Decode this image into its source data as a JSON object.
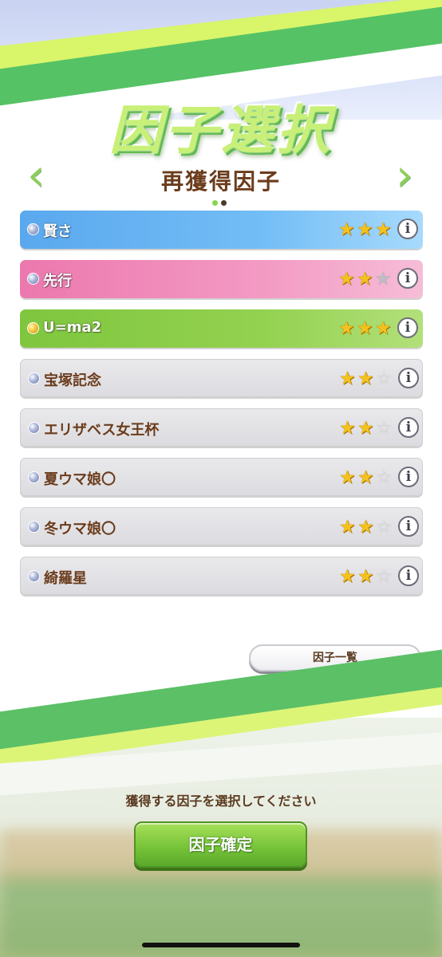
{
  "header": {
    "title": "因子選択",
    "subtitle": "再獲得因子",
    "nav_prev_icon": "chevron-left",
    "nav_next_icon": "chevron-right",
    "page_indicator": {
      "current": 1,
      "total": 2
    }
  },
  "factors": [
    {
      "label": "賢さ",
      "color": "blue",
      "gem": "silver",
      "stars": 3,
      "empty_style": "gray"
    },
    {
      "label": "先行",
      "color": "pink",
      "gem": "silver",
      "stars": 2,
      "empty_style": "gray"
    },
    {
      "label": "U=ma2",
      "color": "green",
      "gem": "gold",
      "stars": 3,
      "empty_style": "gray"
    },
    {
      "label": "宝塚記念",
      "color": "gray",
      "gem": "silver",
      "stars": 2,
      "empty_style": "outline"
    },
    {
      "label": "エリザベス女王杯",
      "color": "gray",
      "gem": "silver",
      "stars": 2,
      "empty_style": "outline"
    },
    {
      "label": "夏ウマ娘〇",
      "color": "gray",
      "gem": "silver",
      "stars": 2,
      "empty_style": "outline"
    },
    {
      "label": "冬ウマ娘〇",
      "color": "gray",
      "gem": "silver",
      "stars": 2,
      "empty_style": "outline"
    },
    {
      "label": "綺羅星",
      "color": "gray",
      "gem": "silver",
      "stars": 2,
      "empty_style": "outline"
    }
  ],
  "info_icon_glyph": "i",
  "factor_list_button": "因子一覧",
  "instruction": "獲得する因子を選択してください",
  "confirm_button": "因子確定",
  "colors": {
    "brown_text": "#6b3c1c",
    "accent_green": "#78c43a",
    "star_gold": "#f4c21d",
    "row_blue": "#73bdf6",
    "row_pink": "#f39ac3",
    "row_green": "#93d150"
  }
}
